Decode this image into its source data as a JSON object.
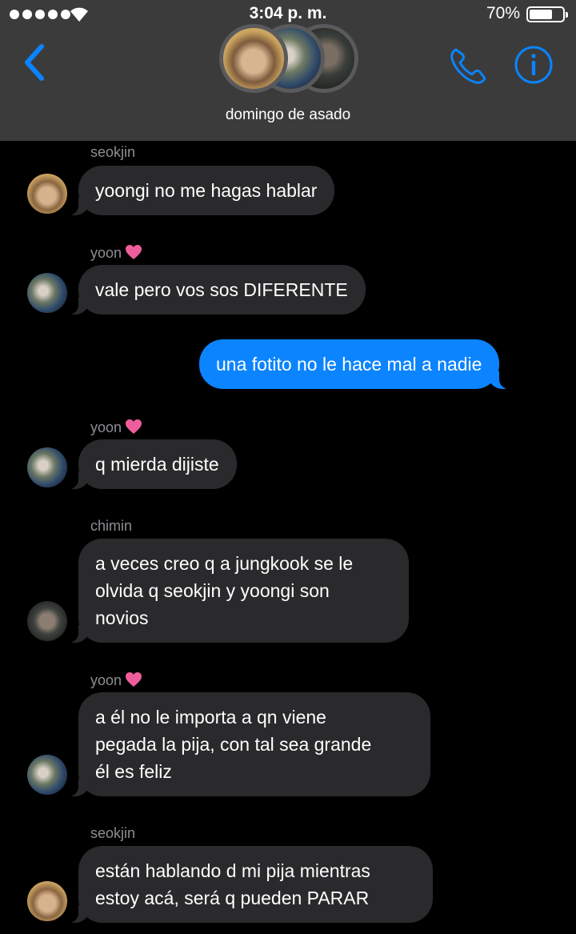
{
  "status_bar": {
    "time": "3:04 p. m.",
    "battery": "70%",
    "battery_level": 0.7
  },
  "header": {
    "group_name": "domingo de asado",
    "accent": "#0a84ff"
  },
  "messages": [
    {
      "sender": "seokjin",
      "text": "yoongi no me hagas hablar",
      "direction": "in"
    },
    {
      "sender": "yoon",
      "sender_emoji": "💗",
      "text": "vale pero vos sos DIFERENTE",
      "direction": "in"
    },
    {
      "text": "una fotito no le hace mal a nadie",
      "direction": "out"
    },
    {
      "sender": "yoon",
      "sender_emoji": "💗",
      "text": "q mierda dijiste",
      "direction": "in"
    },
    {
      "sender": "chimin",
      "text_lines": [
        "a veces creo q a jungkook se le",
        "olvida q seokjin y yoongi son",
        "novios"
      ],
      "direction": "in"
    },
    {
      "sender": "yoon",
      "sender_emoji": "💗",
      "text_lines": [
        "a él no le importa a qn viene",
        "pegada la pija, con tal sea grande",
        "él es feliz"
      ],
      "direction": "in"
    },
    {
      "sender": "seokjin",
      "text_lines": [
        "están hablando d mi pija mientras",
        "estoy acá, será q pueden PARAR"
      ],
      "direction": "in"
    }
  ]
}
